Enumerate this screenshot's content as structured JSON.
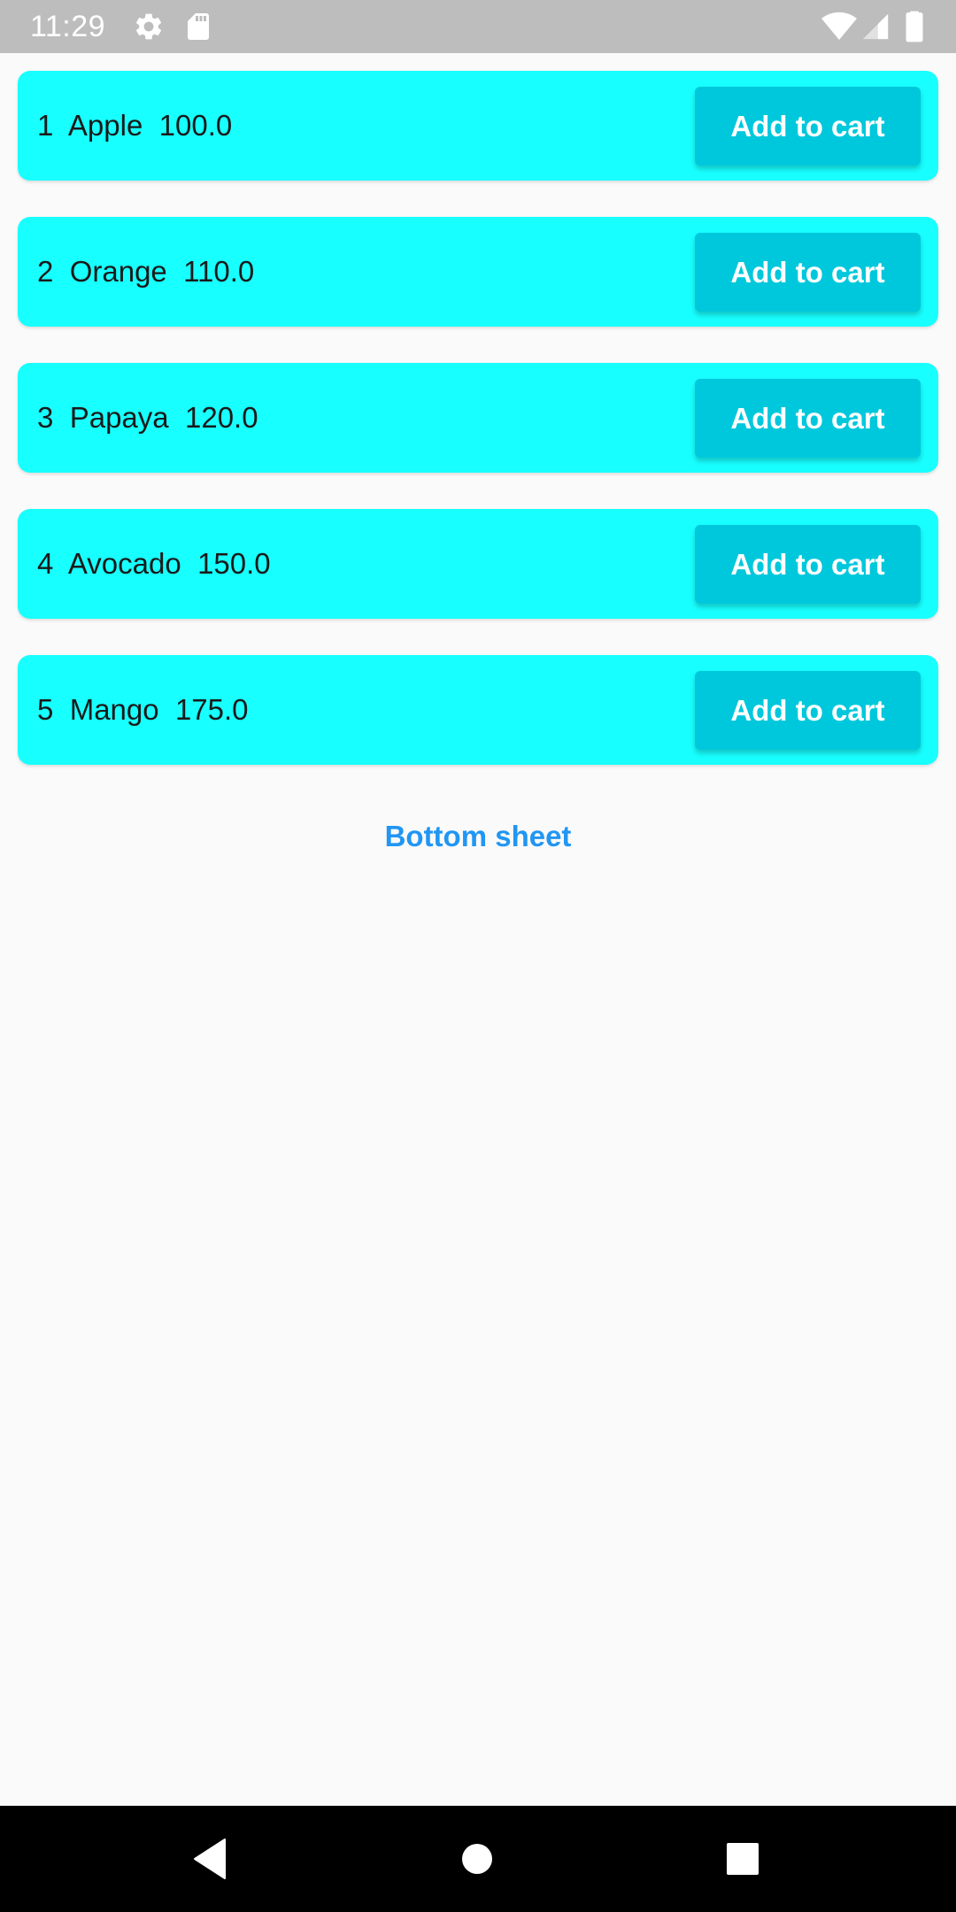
{
  "status_bar": {
    "time": "11:29",
    "icons": [
      "settings-icon",
      "sd-card-icon",
      "wifi-icon",
      "signal-icon",
      "battery-icon"
    ]
  },
  "products": [
    {
      "id": "1",
      "name": "Apple",
      "price": "100.0",
      "button_label": "Add to cart"
    },
    {
      "id": "2",
      "name": "Orange",
      "price": "110.0",
      "button_label": "Add to cart"
    },
    {
      "id": "3",
      "name": "Papaya",
      "price": "120.0",
      "button_label": "Add to cart"
    },
    {
      "id": "4",
      "name": "Avocado",
      "price": "150.0",
      "button_label": "Add to cart"
    },
    {
      "id": "5",
      "name": "Mango",
      "price": "175.0",
      "button_label": "Add to cart"
    }
  ],
  "bottom_sheet_label": "Bottom sheet",
  "nav_bar": {
    "buttons": [
      "back-icon",
      "home-icon",
      "recents-icon"
    ]
  },
  "colors": {
    "card_background": "#18ffff",
    "button_background": "#00c8dc",
    "link": "#2196f3",
    "status_bar": "#bdbdbd"
  }
}
